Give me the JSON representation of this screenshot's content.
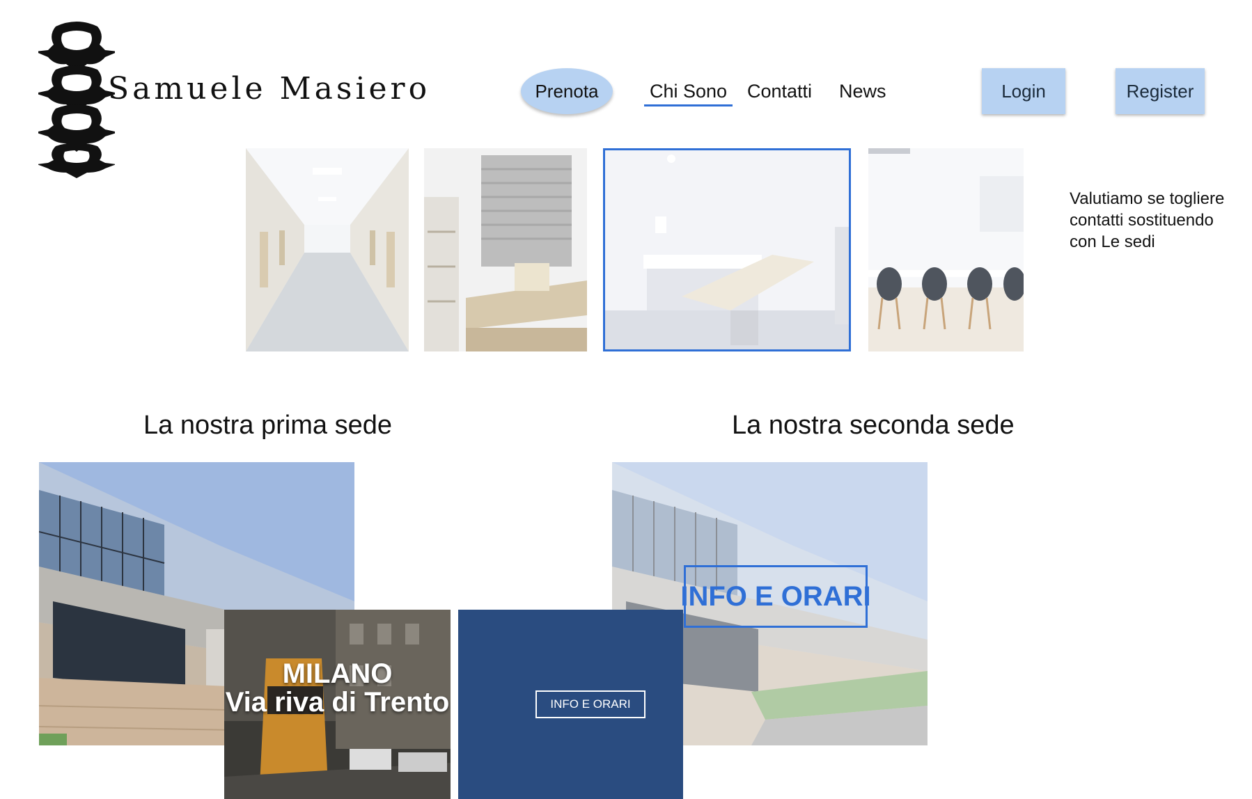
{
  "header": {
    "brand_name": "Samuele Masiero",
    "nav": {
      "prenota": "Prenota",
      "chi_sono": "Chi Sono",
      "contatti": "Contatti",
      "news": "News"
    },
    "login_label": "Login",
    "register_label": "Register",
    "accent_color": "#2f6fd6",
    "button_bg_color": "#b7d2f2"
  },
  "gallery": {
    "images": [
      "hospital-corridor-photo",
      "office-room-photo",
      "examination-room-photo",
      "meeting-room-photo"
    ],
    "selected_index": 2
  },
  "note": {
    "text": "Valutiamo se togliere contatti sostituendo con Le sedi"
  },
  "sections": {
    "first": {
      "title": "La nostra prima sede",
      "city_card": "MILANO\nVia riva di Trento",
      "info_button": "INFO E ORARI",
      "panel_color": "#2a4c80"
    },
    "second": {
      "title": "La nostra seconda sede",
      "info_overlay": "INFO E ORARI"
    }
  }
}
